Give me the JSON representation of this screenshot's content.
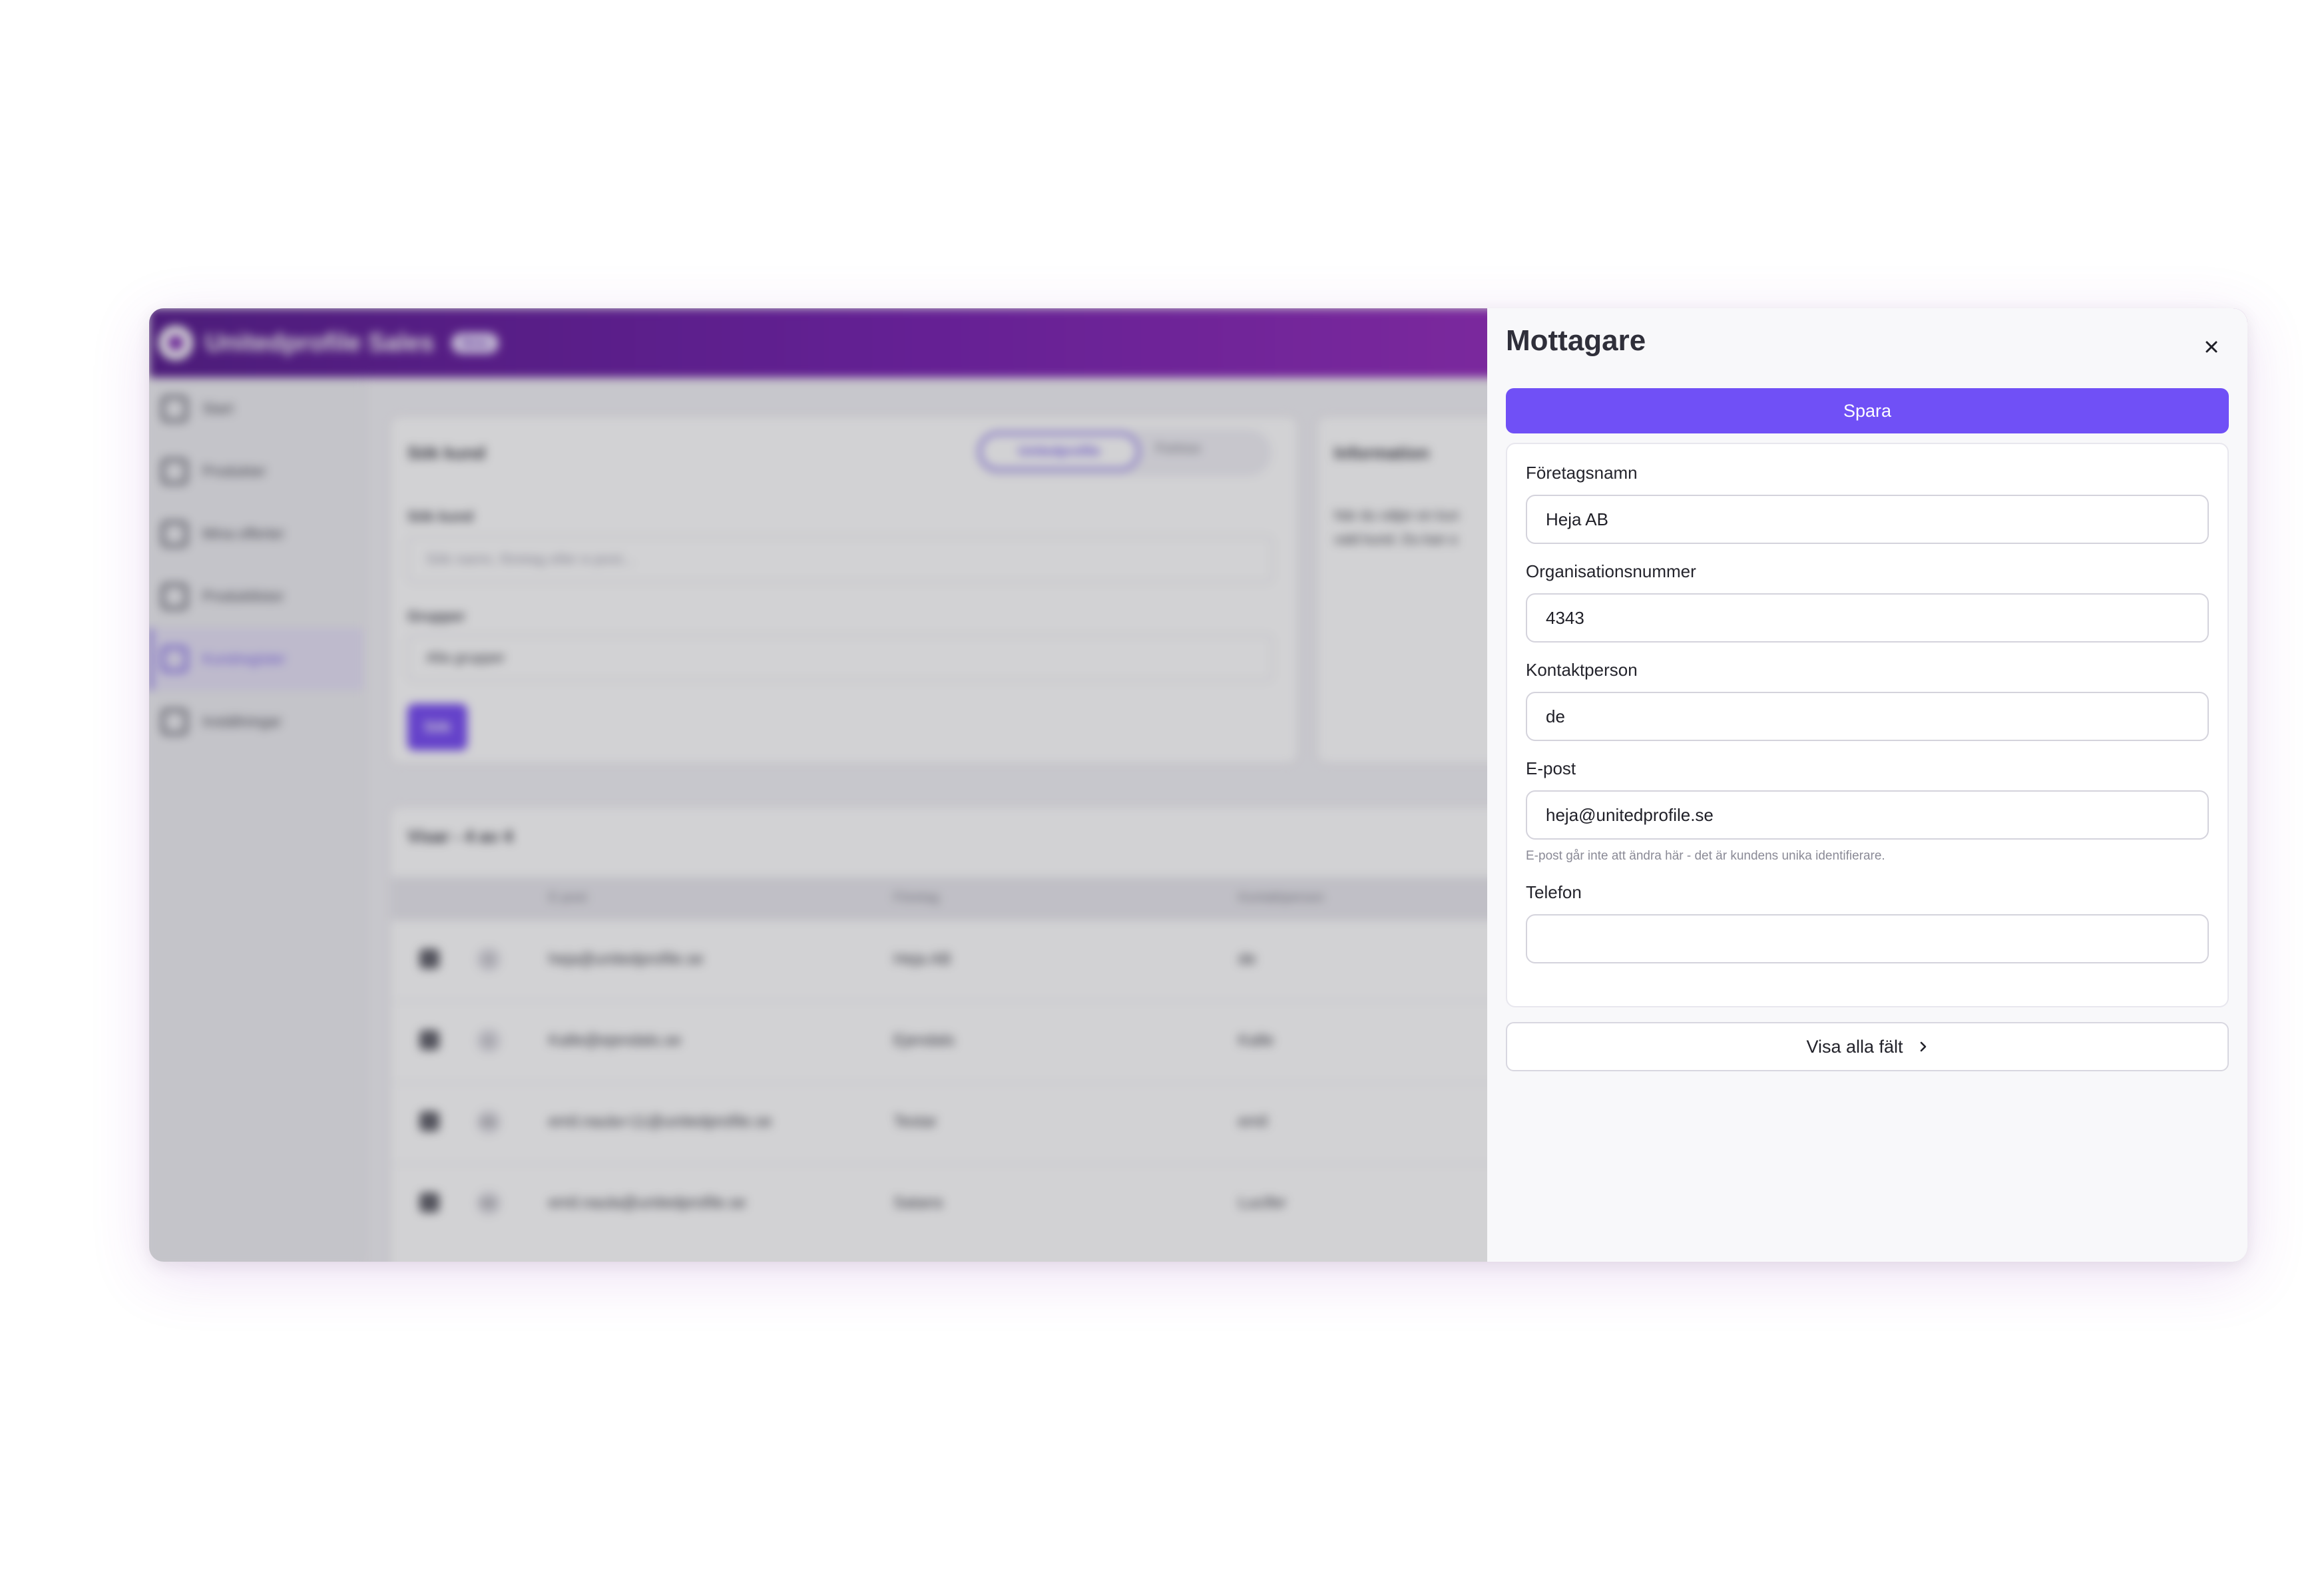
{
  "app": {
    "title": "Unitedprofile Sales",
    "beta": "Beta"
  },
  "sidebar": {
    "items": [
      {
        "label": "Start",
        "icon": "home-icon"
      },
      {
        "label": "Produkter",
        "icon": "box-icon"
      },
      {
        "label": "Mina offerter",
        "icon": "grid-icon"
      },
      {
        "label": "Produktlistor",
        "icon": "list-icon"
      },
      {
        "label": "Kundregister",
        "icon": "users-icon",
        "active": true
      },
      {
        "label": "Inställningar",
        "icon": "gear-icon"
      }
    ]
  },
  "search": {
    "title": "Sök kund",
    "tab_active": "Unitedprofile",
    "tab_other": "Fortnox",
    "search_label": "Sök kund",
    "search_placeholder": "Sök namn, företag eller e-post...",
    "groups_label": "Grupper",
    "groups_value": "Alla grupper",
    "button": "Sök"
  },
  "info": {
    "title": "Information",
    "text_line1": "När du väljer en kun",
    "text_line2": "vald kund. Du kan o"
  },
  "table": {
    "showing": "Visar - 4 av 4",
    "columns": [
      "E-post",
      "Företag",
      "Kontaktperson"
    ],
    "rows": [
      {
        "initials": "H",
        "email": "heja@unitedprofile.se",
        "company": "Heja AB",
        "contact": "de"
      },
      {
        "initials": "K",
        "email": "Kalle@ejendals.se",
        "company": "Ejendals",
        "contact": "Kalle"
      },
      {
        "initials": "EN",
        "email": "emil.naula+11@unitedprofile.se",
        "company": "Testar",
        "contact": "emil"
      },
      {
        "initials": "EN",
        "email": "emil.naula@unitedprofile.se",
        "company": "Satans",
        "contact": "Lucifer"
      }
    ]
  },
  "panel": {
    "title": "Mottagare",
    "save_label": "Spara",
    "fields": {
      "company_label": "Företagsnamn",
      "company_value": "Heja AB",
      "orgnr_label": "Organisationsnummer",
      "orgnr_value": "4343",
      "contact_label": "Kontaktperson",
      "contact_value": "de",
      "email_label": "E-post",
      "email_value": "heja@unitedprofile.se",
      "email_hint": "E-post går inte att ändra här - det är kundens unika identifierare.",
      "phone_label": "Telefon",
      "phone_value": ""
    },
    "show_all_label": "Visa alla fält"
  },
  "colors": {
    "accent": "#7050f6",
    "header_start": "#4b0a86",
    "header_end": "#a428c0"
  }
}
